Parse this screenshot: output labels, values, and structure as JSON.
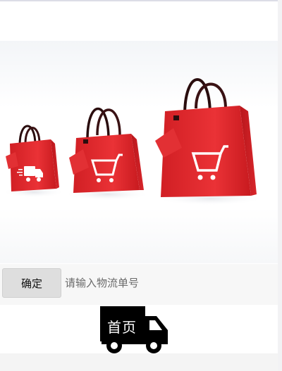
{
  "banner": {
    "icons": [
      "truck-icon",
      "shopping-cart-icon",
      "shopping-cart-icon"
    ],
    "bag_color": "#e52b2f"
  },
  "form": {
    "confirm_label": "确定",
    "tracking_placeholder": "请输入物流单号",
    "tracking_value": ""
  },
  "nav": {
    "home_label": "首页",
    "icon": "delivery-truck-icon"
  }
}
